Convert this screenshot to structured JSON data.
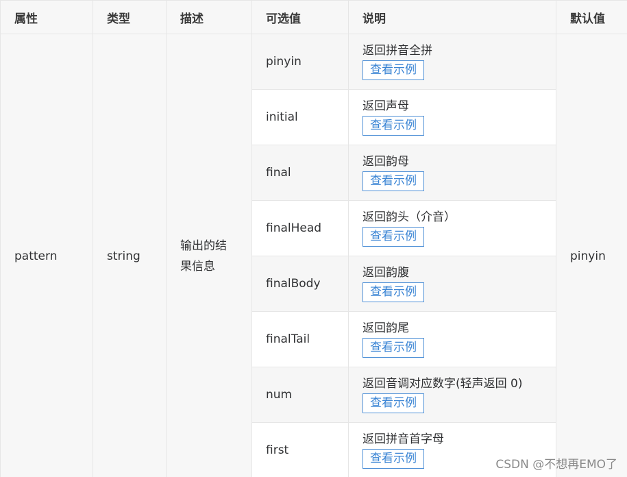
{
  "headers": {
    "attr": "属性",
    "type": "类型",
    "desc": "描述",
    "options": "可选值",
    "note": "说明",
    "default": "默认值"
  },
  "row": {
    "attr": "pattern",
    "type": "string",
    "desc_line1": "输出的结",
    "desc_line2": "果信息",
    "default": "pinyin"
  },
  "options": [
    {
      "value": "pinyin",
      "note": "返回拼音全拼",
      "button": "查看示例"
    },
    {
      "value": "initial",
      "note": "返回声母",
      "button": "查看示例"
    },
    {
      "value": "final",
      "note": "返回韵母",
      "button": "查看示例"
    },
    {
      "value": "finalHead",
      "note": "返回韵头（介音）",
      "button": "查看示例"
    },
    {
      "value": "finalBody",
      "note": "返回韵腹",
      "button": "查看示例"
    },
    {
      "value": "finalTail",
      "note": "返回韵尾",
      "button": "查看示例"
    },
    {
      "value": "num",
      "note": "返回音调对应数字(轻声返回 0)",
      "button": "查看示例"
    },
    {
      "value": "first",
      "note": "返回拼音首字母",
      "button": "查看示例"
    }
  ],
  "watermark": "CSDN @不想再EMO了"
}
